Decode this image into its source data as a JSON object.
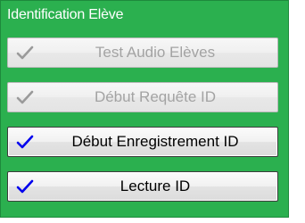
{
  "panel": {
    "title": "Identification Elève",
    "background_color": "#2bb04f"
  },
  "buttons": [
    {
      "label": "Test Audio Elèves",
      "enabled": false,
      "checked": true,
      "icon": "checkmark-icon"
    },
    {
      "label": "Début Requête ID",
      "enabled": false,
      "checked": true,
      "icon": "checkmark-icon"
    },
    {
      "label": "Début Enregistrement ID",
      "enabled": true,
      "checked": true,
      "icon": "checkmark-icon"
    },
    {
      "label": "Lecture ID",
      "enabled": true,
      "checked": true,
      "icon": "checkmark-icon"
    }
  ],
  "colors": {
    "check_enabled": "#0000ee",
    "check_disabled": "#9a9a9a"
  }
}
